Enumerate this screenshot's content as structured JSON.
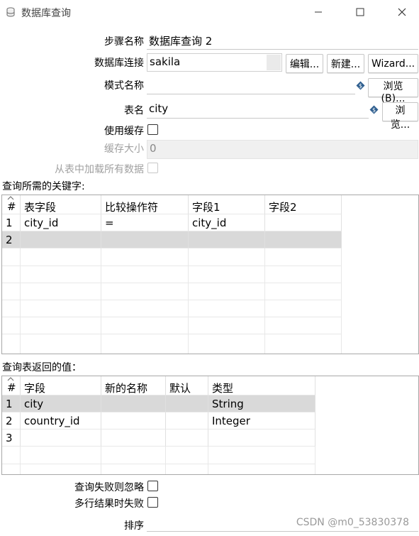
{
  "window": {
    "title": "数据库查询",
    "min_symbol": "—",
    "max_symbol": "☐",
    "close_symbol": "✕"
  },
  "form": {
    "step_name_label": "步骤名称",
    "step_name_value": "数据库查询 2",
    "connection_label": "数据库连接",
    "connection_value": "sakila",
    "edit_btn": "编辑...",
    "new_btn": "新建...",
    "wizard_btn": "Wizard...",
    "schema_label": "模式名称",
    "schema_value": "",
    "browse_b_btn": "浏览(B)...",
    "table_label": "表名",
    "table_value": "city",
    "browse_btn": "浏览...",
    "use_cache_label": "使用缓存",
    "cache_size_label": "缓存大小",
    "cache_size_value": "0",
    "load_all_label": "从表中加载所有数据",
    "fail_ignore_label": "查询失败则忽略",
    "fail_multi_label": "多行结果时失败",
    "order_label": "排序",
    "order_value": ""
  },
  "keys_table": {
    "section_label": "查询所需的关键字:",
    "headers": [
      "#",
      "表字段",
      "比较操作符",
      "字段1",
      "字段2"
    ],
    "rows": [
      [
        "1",
        "city_id",
        "=",
        "city_id",
        ""
      ],
      [
        "2",
        "",
        "",
        "",
        ""
      ]
    ]
  },
  "return_table": {
    "section_label": "查询表返回的值：",
    "headers": [
      "#",
      "字段",
      "新的名称",
      "默认",
      "类型"
    ],
    "rows": [
      [
        "1",
        "city",
        "",
        "",
        "String"
      ],
      [
        "2",
        "country_id",
        "",
        "",
        "Integer"
      ],
      [
        "3",
        "",
        "",
        "",
        ""
      ]
    ]
  },
  "watermark": "CSDN @m0_53830378",
  "icons": {
    "app": "database-icon",
    "variable": "variable-icon"
  },
  "colors": {
    "selected_row": "#d9d9d9",
    "variable_icon": "#2f5f8f"
  }
}
